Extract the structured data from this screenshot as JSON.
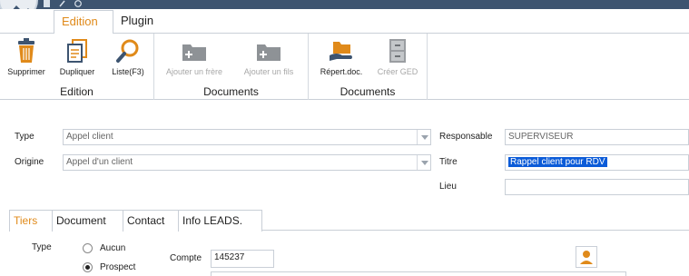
{
  "ribbon": {
    "tabs": [
      "Edition",
      "Plugin"
    ],
    "groups": [
      {
        "title": "Edition",
        "buttons": [
          "Supprimer",
          "Dupliquer",
          "Liste(F3)"
        ]
      },
      {
        "title": "Documents",
        "buttons": [
          "Ajouter un frère",
          "Ajouter un  fils"
        ]
      },
      {
        "title": "Documents",
        "buttons": [
          "Répert.doc.",
          "Créer GED"
        ]
      }
    ]
  },
  "form": {
    "type_label": "Type",
    "type_value": "Appel client",
    "origine_label": "Origine",
    "origine_value": "Appel d'un client",
    "responsable_label": "Responsable",
    "responsable_value": "SUPERVISEUR",
    "titre_label": "Titre",
    "titre_value": "Rappel client pour RDV",
    "lieu_label": "Lieu",
    "lieu_value": ""
  },
  "subtabs": [
    "Tiers",
    "Document",
    "Contact",
    "Info LEADS."
  ],
  "tiers": {
    "type_label": "Type",
    "options": [
      "Aucun",
      "Prospect"
    ],
    "selected": "Prospect",
    "compte_label": "Compte",
    "compte_value": "145237"
  },
  "colors": {
    "accent": "#e08a1a",
    "titlebar": "#3d5470",
    "selection": "#0b5bd8"
  }
}
